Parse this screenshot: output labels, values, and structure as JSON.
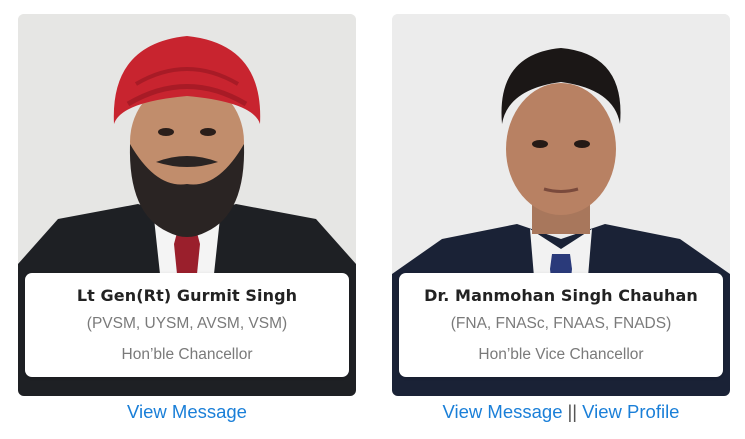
{
  "officials": [
    {
      "name": "Lt Gen(Rt) Gurmit Singh",
      "honors": "(PVSM, UYSM, AVSM, VSM)",
      "role": "Hon’ble Chancellor",
      "links": [
        "View Message"
      ]
    },
    {
      "name": "Dr. Manmohan Singh Chauhan",
      "honors": "(FNA, FNASc, FNAAS, FNADS)",
      "role": "Hon’ble Vice Chancellor",
      "links": [
        "View Message",
        "View Profile"
      ],
      "link_separator": "||"
    }
  ],
  "colors": {
    "link": "#1a7fd8",
    "muted_text": "#7a7a7a",
    "name_text": "#222222",
    "turban_red": "#c8242f"
  }
}
